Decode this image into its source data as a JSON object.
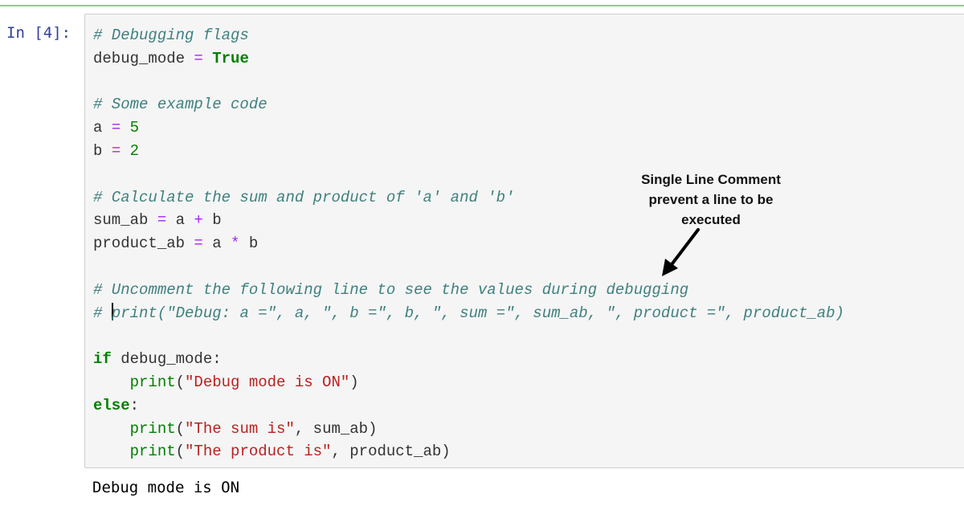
{
  "cell": {
    "prompt": "In [4]:",
    "execution_count": 4,
    "lines": [
      [
        {
          "t": "# Debugging flags",
          "c": "cm"
        }
      ],
      [
        {
          "t": "debug_mode ",
          "c": ""
        },
        {
          "t": "=",
          "c": "op"
        },
        {
          "t": " ",
          "c": ""
        },
        {
          "t": "True",
          "c": "kw"
        }
      ],
      [],
      [
        {
          "t": "# Some example code",
          "c": "cm"
        }
      ],
      [
        {
          "t": "a ",
          "c": ""
        },
        {
          "t": "=",
          "c": "op"
        },
        {
          "t": " ",
          "c": ""
        },
        {
          "t": "5",
          "c": "num"
        }
      ],
      [
        {
          "t": "b ",
          "c": ""
        },
        {
          "t": "=",
          "c": "op"
        },
        {
          "t": " ",
          "c": ""
        },
        {
          "t": "2",
          "c": "num"
        }
      ],
      [],
      [
        {
          "t": "# Calculate the sum and product of 'a' and 'b'",
          "c": "cm"
        }
      ],
      [
        {
          "t": "sum_ab ",
          "c": ""
        },
        {
          "t": "=",
          "c": "op"
        },
        {
          "t": " a ",
          "c": ""
        },
        {
          "t": "+",
          "c": "op"
        },
        {
          "t": " b",
          "c": ""
        }
      ],
      [
        {
          "t": "product_ab ",
          "c": ""
        },
        {
          "t": "=",
          "c": "op"
        },
        {
          "t": " a ",
          "c": ""
        },
        {
          "t": "*",
          "c": "op"
        },
        {
          "t": " b",
          "c": ""
        }
      ],
      [],
      [
        {
          "t": "# Uncomment the following line to see the values during debugging",
          "c": "cm"
        }
      ],
      [
        {
          "t": "# ",
          "c": "cm"
        },
        {
          "t": "",
          "c": "cursor"
        },
        {
          "t": "print(\"Debug: a =\", a, \", b =\", b, \", sum =\", sum_ab, \", product =\", product_ab)",
          "c": "cm"
        }
      ],
      [],
      [
        {
          "t": "if",
          "c": "kw"
        },
        {
          "t": " debug_mode:",
          "c": ""
        }
      ],
      [
        {
          "t": "    ",
          "c": ""
        },
        {
          "t": "print",
          "c": "bi"
        },
        {
          "t": "(",
          "c": ""
        },
        {
          "t": "\"Debug mode is ON\"",
          "c": "str"
        },
        {
          "t": ")",
          "c": ""
        }
      ],
      [
        {
          "t": "else",
          "c": "kw"
        },
        {
          "t": ":",
          "c": ""
        }
      ],
      [
        {
          "t": "    ",
          "c": ""
        },
        {
          "t": "print",
          "c": "bi"
        },
        {
          "t": "(",
          "c": ""
        },
        {
          "t": "\"The sum is\"",
          "c": "str"
        },
        {
          "t": ", sum_ab)",
          "c": ""
        }
      ],
      [
        {
          "t": "    ",
          "c": ""
        },
        {
          "t": "print",
          "c": "bi"
        },
        {
          "t": "(",
          "c": ""
        },
        {
          "t": "\"The product is\"",
          "c": "str"
        },
        {
          "t": ", product_ab)",
          "c": ""
        }
      ]
    ]
  },
  "annotation": {
    "lines": [
      "Single Line Comment",
      "prevent a line to be",
      "executed"
    ]
  },
  "output": {
    "text": "Debug mode is ON"
  },
  "colors": {
    "cell_border_active": "#8fcb8f",
    "prompt": "#303f9f",
    "comment": "#408080",
    "keyword": "#008000",
    "operator": "#aa22ff",
    "string": "#ba2121"
  }
}
